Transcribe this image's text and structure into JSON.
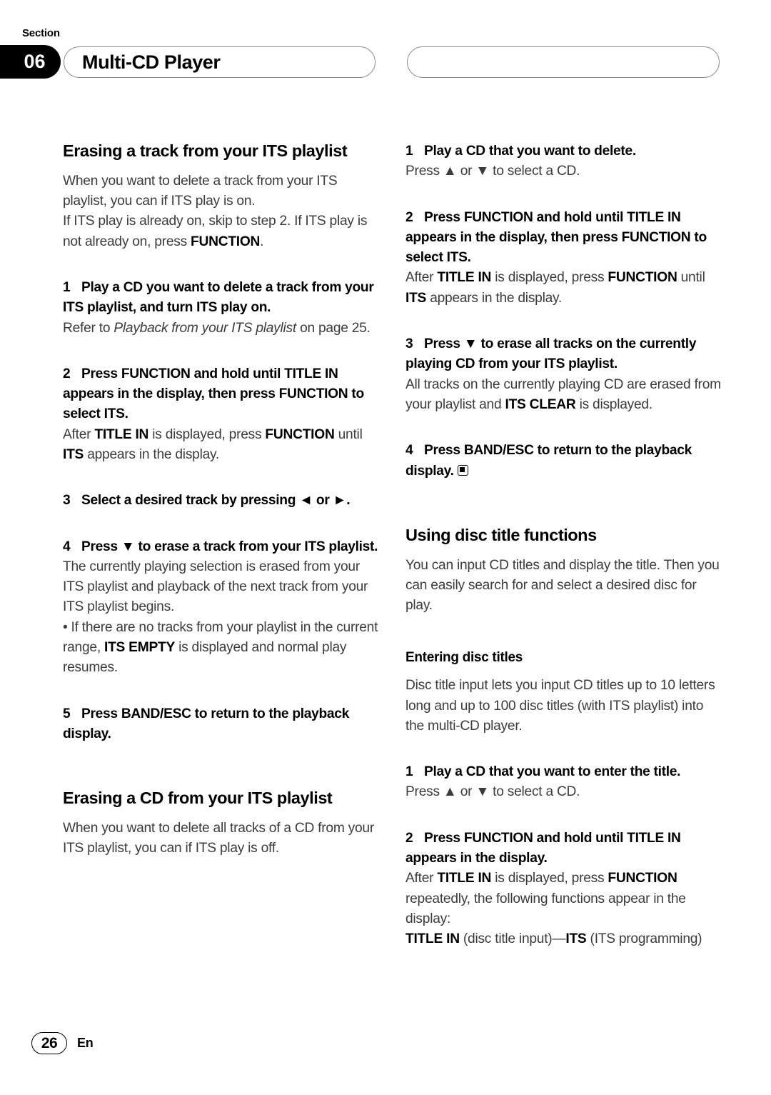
{
  "header": {
    "section_label": "Section",
    "section_number": "06",
    "title": "Multi-CD Player"
  },
  "footer": {
    "page_number": "26",
    "language_code": "En"
  },
  "left_column": {
    "heading_1": "Erasing a track from your ITS playlist",
    "intro_line_1": "When you want to delete a track from your ITS playlist, you can if ITS play is on.",
    "intro_line_2_a": "If ITS play is already on, skip to step 2. If ITS play is not already on, press ",
    "intro_line_2_bold": "FUNCTION",
    "intro_line_2_b": ".",
    "step1_num": "1",
    "step1_text": "Play a CD you want to delete a track from your ITS playlist, and turn ITS play on.",
    "step1_note_a": "Refer to ",
    "step1_note_italic": "Playback from your ITS playlist",
    "step1_note_b": " on page 25.",
    "step2_num": "2",
    "step2_text_a": "Press ",
    "step2_bold_1": "FUNCTION",
    "step2_text_b": " and hold until ",
    "step2_bold_2": "TITLE IN",
    "step2_text_c": " appears in the display, then press ",
    "step2_bold_3": "FUNCTION",
    "step2_text_d": " to select ",
    "step2_bold_4": "ITS",
    "step2_text_e": ".",
    "step2_note_a": "After ",
    "step2_note_bold_1": "TITLE IN",
    "step2_note_b": " is displayed, press ",
    "step2_note_bold_2": "FUNCTION",
    "step2_note_c": " until ",
    "step2_note_bold_3": "ITS",
    "step2_note_d": " appears in the display.",
    "step3_num": "3",
    "step3_text": "Select a desired track by pressing ◄ or ►.",
    "step4_num": "4",
    "step4_text": "Press ▼ to erase a track from your ITS playlist.",
    "step4_note_1": "The currently playing selection is erased from your ITS playlist and playback of the next track from your ITS playlist begins.",
    "step4_bullet_a": "• If there are no tracks from your playlist in the current range, ",
    "step4_bullet_bold": "ITS EMPTY",
    "step4_bullet_b": " is displayed and normal play resumes.",
    "step5_num": "5",
    "step5_text_a": "Press ",
    "step5_bold": "BAND/ESC",
    "step5_text_b": " to return to the playback display.",
    "heading_2": "Erasing a CD from your ITS playlist",
    "heading_2_intro": "When you want to delete all tracks of a CD from your ITS playlist, you can if ITS play is off."
  },
  "right_column": {
    "step1_num": "1",
    "step1_text": "Play a CD that you want to delete.",
    "step1_note": "Press ▲ or ▼ to select a CD.",
    "step2_num": "2",
    "step2_text_a": "Press ",
    "step2_bold_1": "FUNCTION",
    "step2_text_b": " and hold until ",
    "step2_bold_2": "TITLE IN",
    "step2_text_c": " appears in the display, then press ",
    "step2_bold_3": "FUNCTION",
    "step2_text_d": " to select ",
    "step2_bold_4": "ITS",
    "step2_text_e": ".",
    "step2_note_a": "After ",
    "step2_note_bold_1": "TITLE IN",
    "step2_note_b": " is displayed, press ",
    "step2_note_bold_2": "FUNCTION",
    "step2_note_c": " until ",
    "step2_note_bold_3": "ITS",
    "step2_note_d": " appears in the display.",
    "step3_num": "3",
    "step3_text": "Press ▼ to erase all tracks on the currently playing CD from your ITS playlist.",
    "step3_note_a": "All tracks on the currently playing CD are erased from your playlist and ",
    "step3_note_bold": "ITS CLEAR",
    "step3_note_b": " is displayed.",
    "step4_num": "4",
    "step4_text_a": "Press ",
    "step4_bold": "BAND/ESC",
    "step4_text_b": " to return to the playback display.",
    "heading_1": "Using disc title functions",
    "heading_1_intro": "You can input CD titles and display the title. Then you can easily search for and select a desired disc for play.",
    "heading_2": "Entering disc titles",
    "heading_2_intro": "Disc title input lets you input CD titles up to 10 letters long and up to 100 disc titles (with ITS playlist) into the multi-CD player.",
    "t_step1_num": "1",
    "t_step1_text": "Play a CD that you want to enter the title.",
    "t_step1_note": "Press ▲ or ▼ to select a CD.",
    "t_step2_num": "2",
    "t_step2_text_a": "Press ",
    "t_step2_bold_1": "FUNCTION",
    "t_step2_text_b": " and hold until ",
    "t_step2_bold_2": "TITLE IN",
    "t_step2_text_c": " appears in the display.",
    "t_step2_note_a": "After ",
    "t_step2_note_bold_1": "TITLE IN",
    "t_step2_note_b": " is displayed, press ",
    "t_step2_note_bold_2": "FUNCTION",
    "t_step2_note_c": " repeatedly, the following functions appear in the display:",
    "t_step2_fn_bold_1": "TITLE IN",
    "t_step2_fn_a": " (disc title input)—",
    "t_step2_fn_bold_2": "ITS",
    "t_step2_fn_b": " (ITS programming)"
  }
}
